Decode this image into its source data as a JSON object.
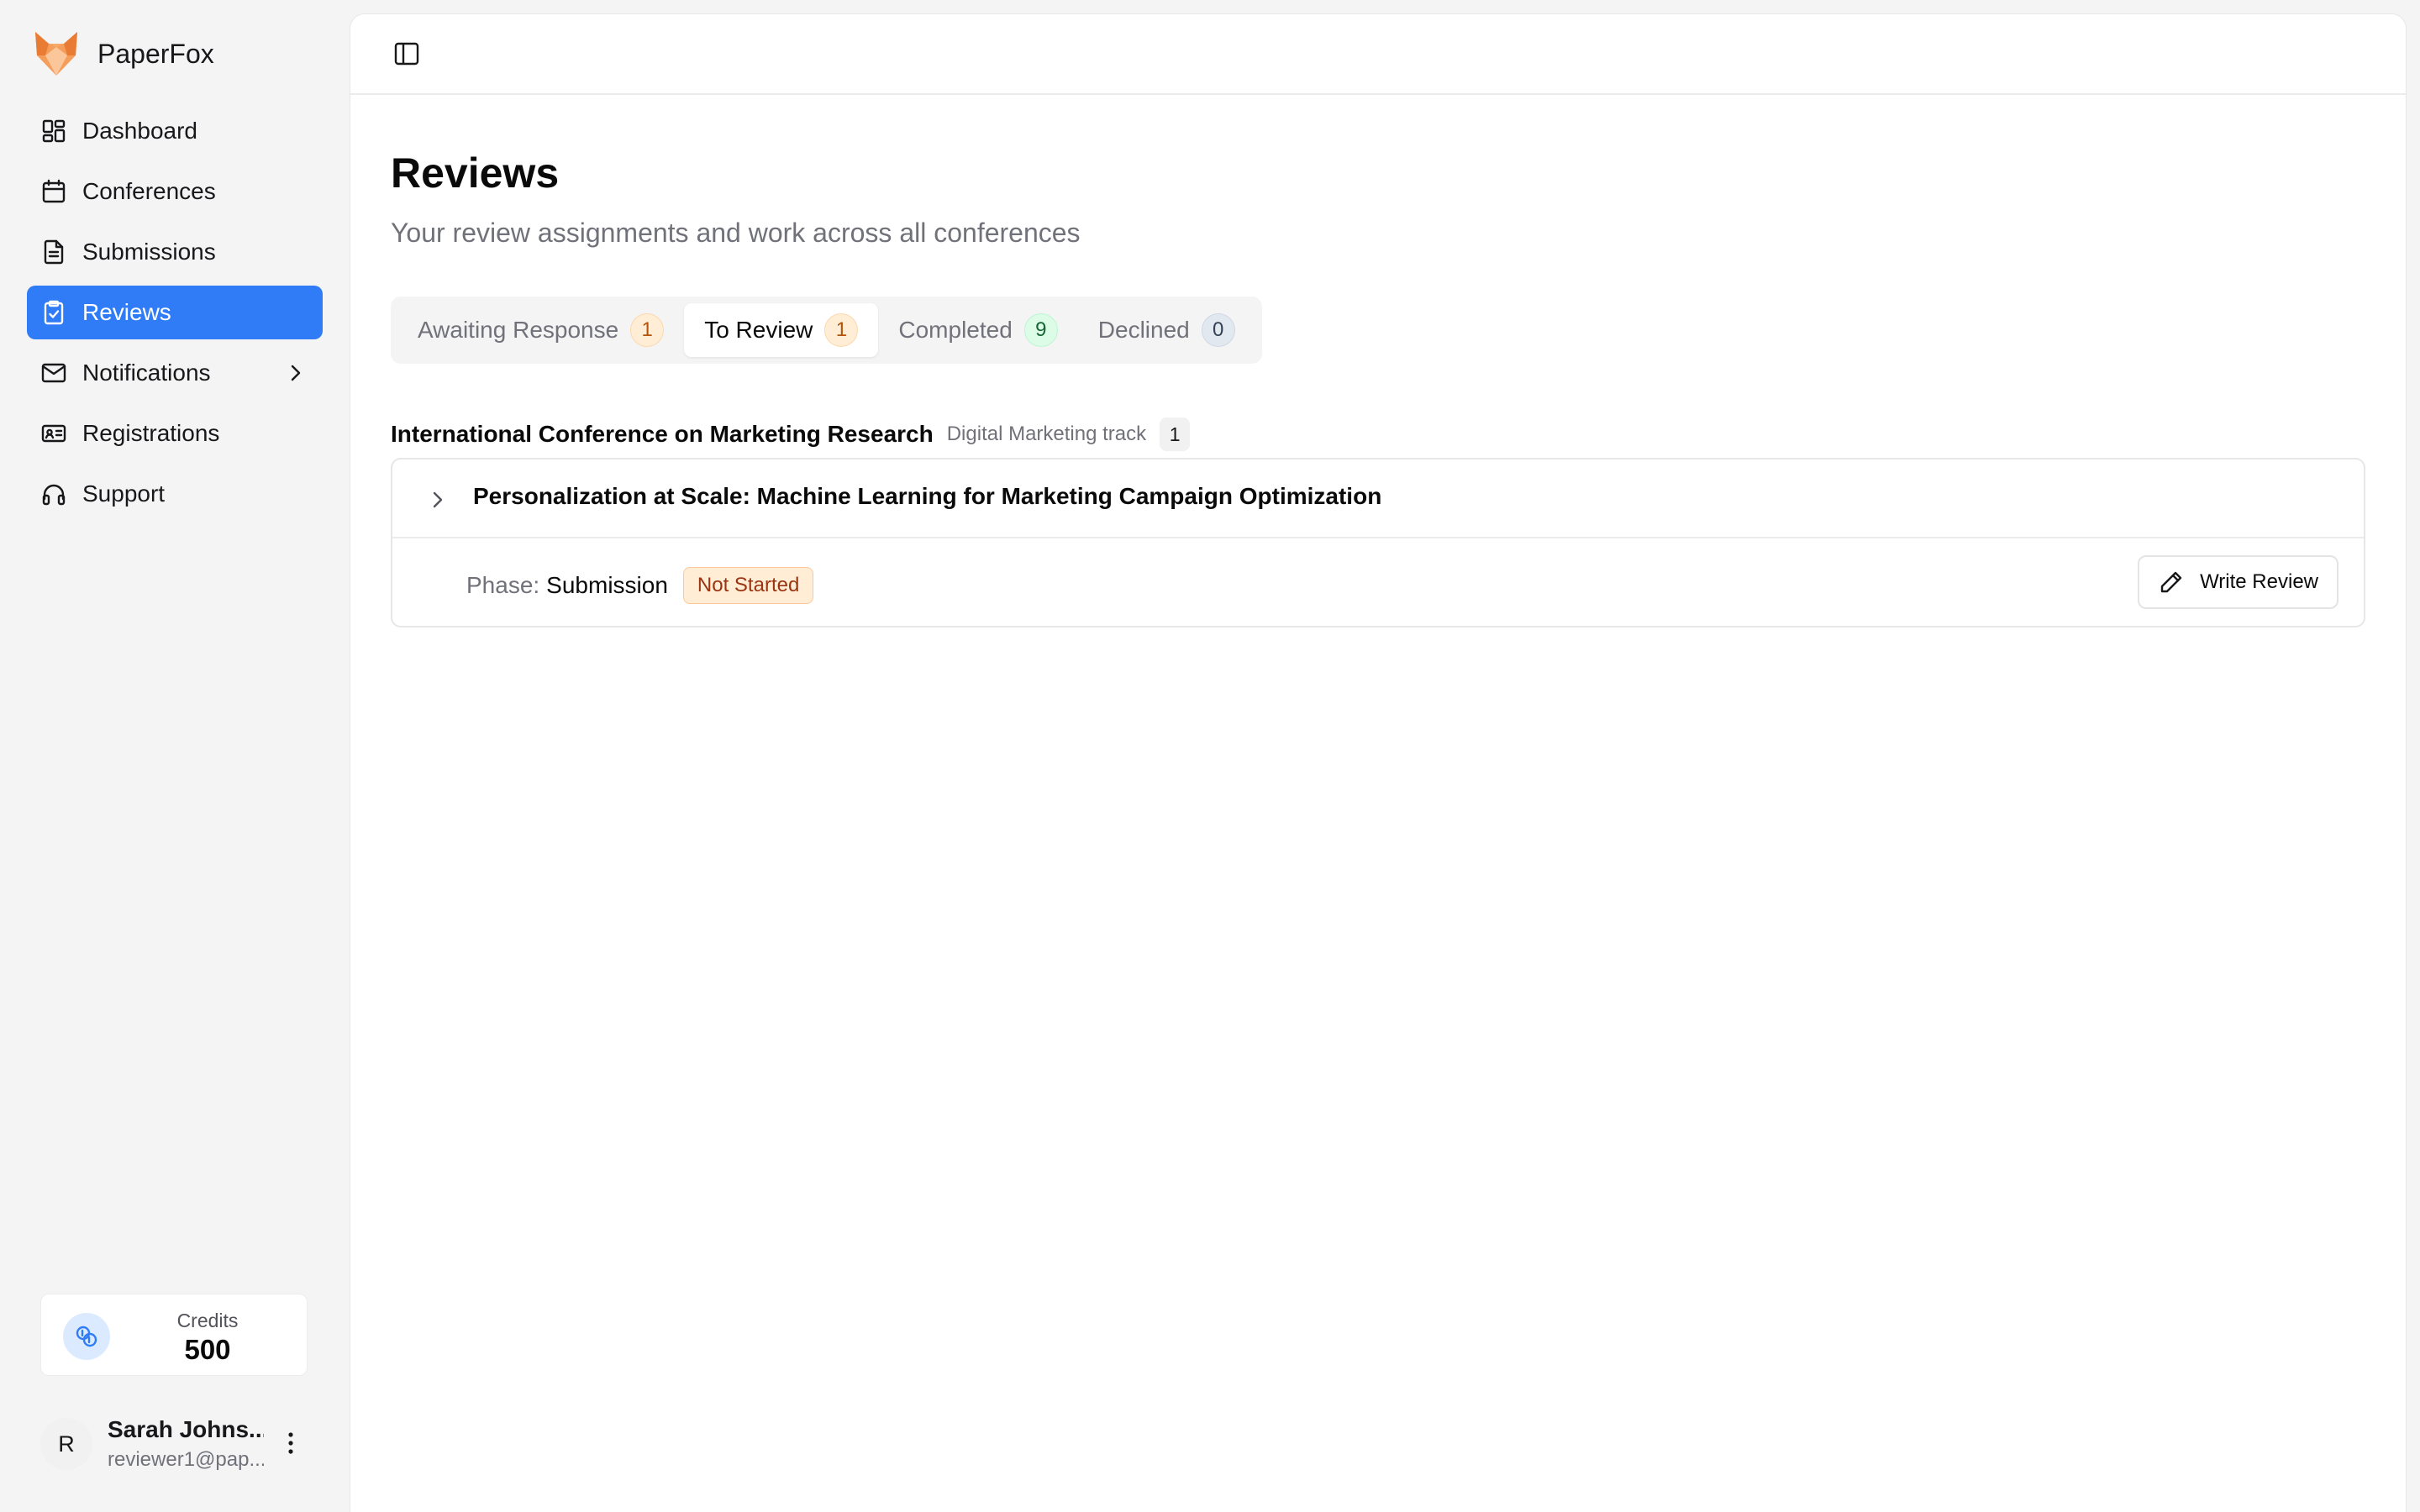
{
  "brand": {
    "name": "PaperFox",
    "logo_icon": "fox-logo-icon"
  },
  "sidebar": {
    "items": [
      {
        "label": "Dashboard",
        "icon": "dashboard-icon"
      },
      {
        "label": "Conferences",
        "icon": "calendar-icon"
      },
      {
        "label": "Submissions",
        "icon": "document-icon"
      },
      {
        "label": "Reviews",
        "icon": "clipboard-check-icon",
        "active": true
      },
      {
        "label": "Notifications",
        "icon": "mail-icon",
        "has_submenu": true
      },
      {
        "label": "Registrations",
        "icon": "id-card-icon"
      },
      {
        "label": "Support",
        "icon": "headphones-icon"
      }
    ]
  },
  "credits": {
    "label": "Credits",
    "value": "500",
    "icon": "coins-icon"
  },
  "user": {
    "initial": "R",
    "name": "Sarah Johns...",
    "email": "reviewer1@pap..."
  },
  "page": {
    "title": "Reviews",
    "subtitle": "Your review assignments and work across all conferences"
  },
  "tabs": [
    {
      "label": "Awaiting Response",
      "count": "1",
      "badge_color": "#ffedd5"
    },
    {
      "label": "To Review",
      "count": "1",
      "badge_color": "#ffedd5",
      "active": true
    },
    {
      "label": "Completed",
      "count": "9",
      "badge_color": "#dcfce7"
    },
    {
      "label": "Declined",
      "count": "0",
      "badge_color": "#e2e8f0"
    }
  ],
  "group": {
    "conference": "International Conference on Marketing Research",
    "track": "Digital Marketing track",
    "count": "1"
  },
  "assignment": {
    "title": "Personalization at Scale: Machine Learning for Marketing Campaign Optimization",
    "phase_label": "Phase:",
    "phase_value": "Submission",
    "status": "Not Started",
    "action_label": "Write Review"
  },
  "colors": {
    "accent": "#2f7cf6",
    "status_bg": "#ffedd5",
    "status_text": "#9a3412"
  }
}
